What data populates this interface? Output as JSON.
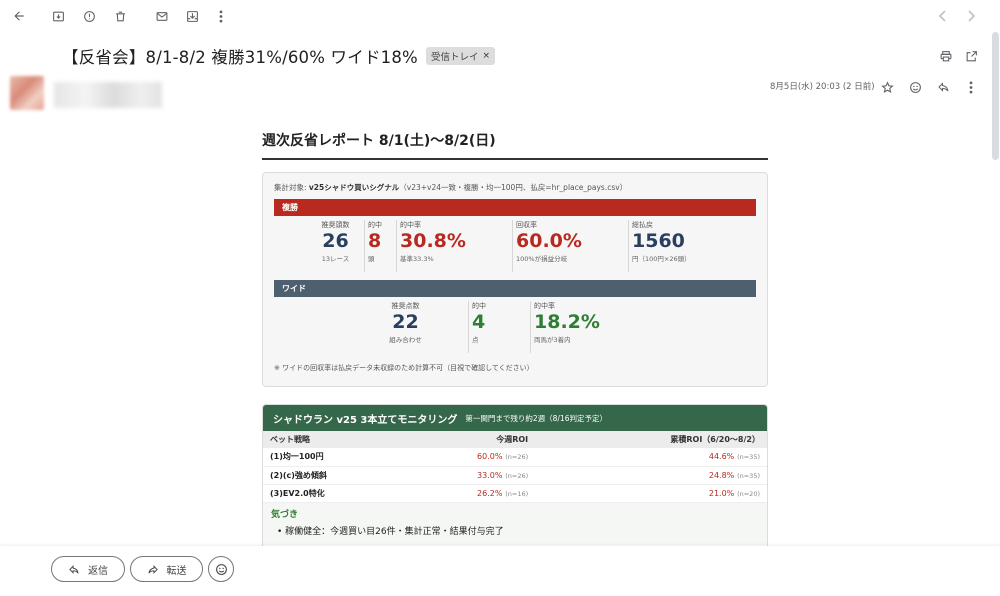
{
  "toolbar": {
    "icons": [
      "back-arrow-icon",
      "archive-icon",
      "report-spam-icon",
      "delete-icon",
      "mark-unread-icon",
      "move-to-icon",
      "more-vert-icon",
      "prev-chevron-icon",
      "next-chevron-icon"
    ]
  },
  "header": {
    "subject": "【反省会】8/1-8/2 複勝31%/60% ワイド18%",
    "label_chip": "受信トレイ",
    "label_chip_close": "×",
    "date": "8月5日(水) 20:03 (2 日前)"
  },
  "report": {
    "title": "週次反省レポート 8/1(土)〜8/2(日)",
    "target_label": "集計対象: ",
    "target_name": "v25シャドウ買いシグナル",
    "target_detail": "（v23+v24一致・複勝・均一100円、払戻=hr_place_pays.csv）",
    "place": {
      "header": "複勝",
      "stats": [
        {
          "label": "推奨頭数",
          "value": "26",
          "sub": "13レース"
        },
        {
          "label": "的中",
          "value": "8",
          "sub": "頭"
        },
        {
          "label": "的中率",
          "value": "30.8%",
          "sub": "基準33.3%"
        },
        {
          "label": "回収率",
          "value": "60.0%",
          "sub": "100%が損益分岐"
        },
        {
          "label": "総払戻",
          "value": "1560",
          "sub": "円（100円×26頭）"
        }
      ]
    },
    "wide": {
      "header": "ワイド",
      "stats": [
        {
          "label": "推奨点数",
          "value": "22",
          "sub": "組み合わせ"
        },
        {
          "label": "的中",
          "value": "4",
          "sub": "点"
        },
        {
          "label": "的中率",
          "value": "18.2%",
          "sub": "両馬が3着内"
        }
      ]
    },
    "note": "※ ワイドの回収率は払戻データ未収録のため計算不可（目視で確認してください）"
  },
  "monitor": {
    "title": "シャドウラン v25 3本立てモニタリング",
    "subtitle": "第一関門まで残り約2週（8/16判定予定）",
    "columns": [
      "ベット戦略",
      "今週ROI",
      "累積ROI（6/20〜8/2）"
    ],
    "rows": [
      {
        "strategy": "(1)均一100円",
        "week_roi": "60.0%",
        "week_n": "(n=26)",
        "cum_roi": "44.6%",
        "cum_n": "(n=35)"
      },
      {
        "strategy": "(2)(c)強め傾斜",
        "week_roi": "33.0%",
        "week_n": "(n=26)",
        "cum_roi": "24.8%",
        "cum_n": "(n=35)"
      },
      {
        "strategy": "(3)EV2.0特化",
        "week_roi": "26.2%",
        "week_n": "(n=16)",
        "cum_roi": "21.0%",
        "cum_n": "(n=20)"
      }
    ],
    "notice_heading": "気づき",
    "notice_item": "稼働健全：今週買い目26件・集計正常・結果付与完了"
  },
  "actions": {
    "reply": "返信",
    "forward": "転送"
  },
  "colors": {
    "place_header": "#b8291f",
    "wide_header": "#4e5f70",
    "monitor_header": "#35684a",
    "value_navy": "#2a3f5f",
    "value_red": "#b8291f",
    "value_green": "#2e7d32"
  }
}
